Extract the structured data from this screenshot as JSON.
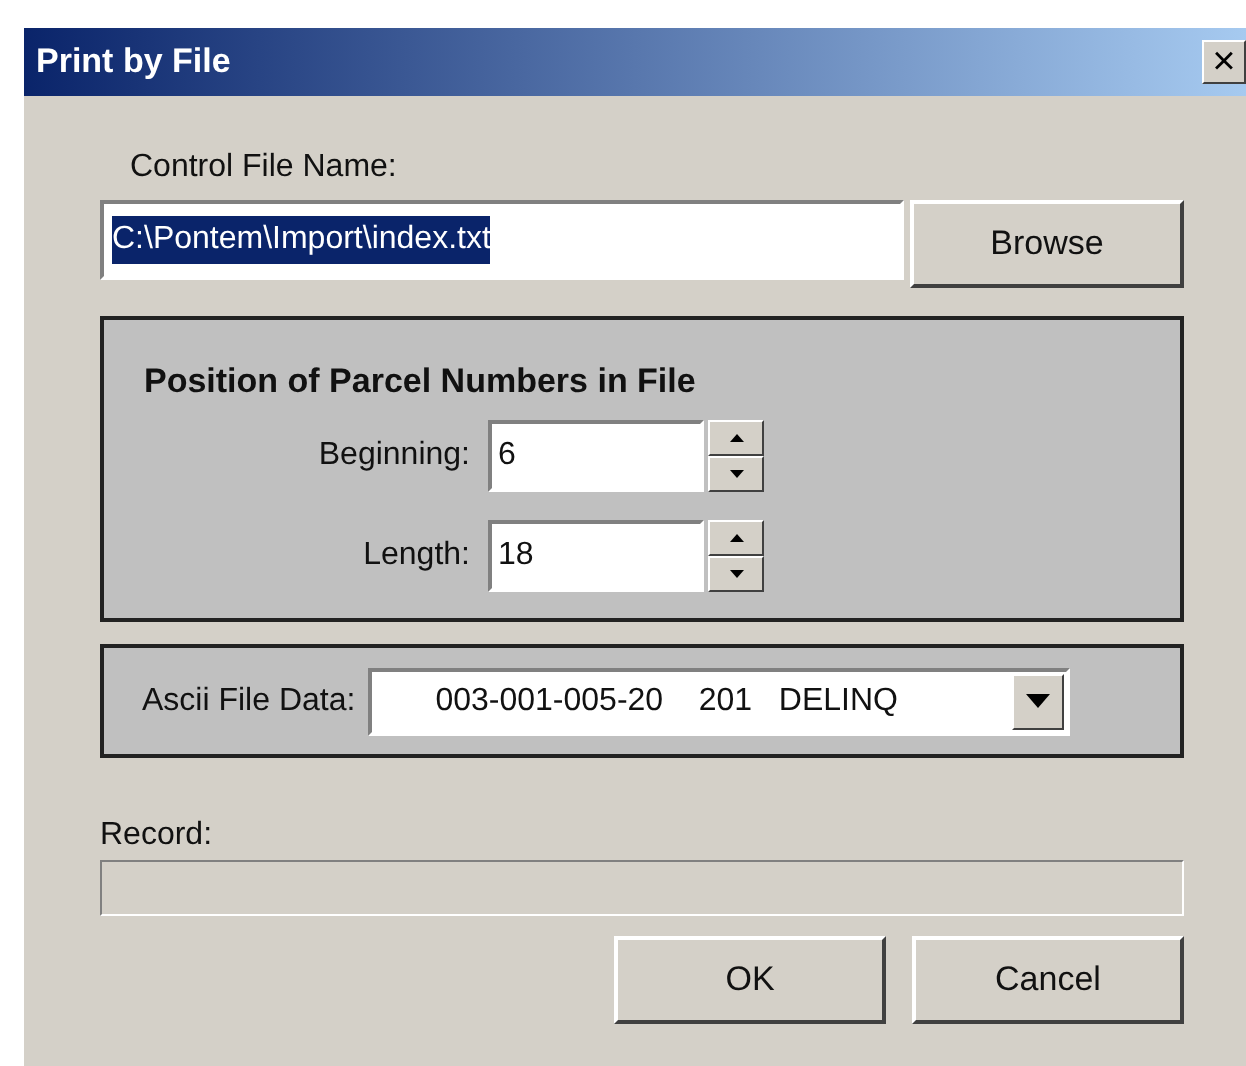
{
  "window": {
    "title": "Print by File",
    "close": "×"
  },
  "control_file": {
    "label": "Control File Name:",
    "value": "C:\\Pontem\\Import\\index.txt",
    "selected": true,
    "browse": "Browse"
  },
  "position_panel": {
    "title": "Position of Parcel Numbers in File",
    "fields": [
      {
        "label": "Beginning:",
        "value": "6"
      },
      {
        "label": "Length:",
        "value": "18"
      }
    ]
  },
  "ascii_panel": {
    "label": "Ascii File Data:",
    "value": "003-001-005-20    201   DELINQ"
  },
  "record": {
    "label": "Record:",
    "level": 0
  },
  "buttons": [
    "OK",
    "Cancel"
  ]
}
